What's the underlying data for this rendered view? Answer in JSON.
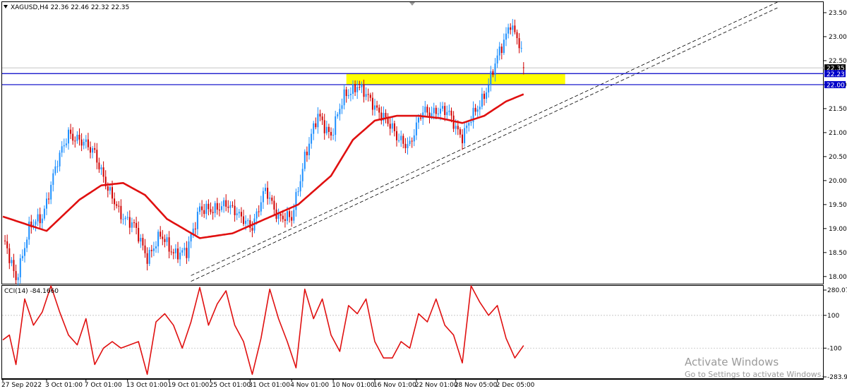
{
  "header": {
    "symbol_info": "XAGUSD,H4  22.36 22.46 22.32 22.35"
  },
  "indicator": {
    "label": "CCI(14) -84.1660",
    "levels": [
      "280.072",
      "100",
      "-100",
      "-283.925"
    ]
  },
  "price_axis": {
    "ticks": [
      "23.50",
      "23.00",
      "22.50",
      "22.00",
      "21.50",
      "21.00",
      "20.50",
      "20.00",
      "19.50",
      "19.00",
      "18.50",
      "18.00"
    ]
  },
  "time_axis": {
    "ticks": [
      "27 Sep 2022",
      "3 Oct 01:00",
      "7 Oct 01:00",
      "13 Oct 01:00",
      "19 Oct 01:00",
      "25 Oct 01:00",
      "31 Oct 01:00",
      "4 Nov 01:00",
      "10 Nov 01:00",
      "16 Nov 01:00",
      "22 Nov 01:00",
      "28 Nov 05:00",
      "2 Dec 05:00"
    ]
  },
  "markers": {
    "current_price": "22.35",
    "level_upper": "22.23",
    "level_lower": "22.00"
  },
  "watermark": {
    "title": "Activate Windows",
    "subtitle": "Go to Settings to activate Windows."
  },
  "colors": {
    "bull_candle": "#1e90ff",
    "bear_candle": "#d00000",
    "moving_average": "#e01010",
    "cci_line": "#e01010",
    "level_line": "#0000c8",
    "zone_fill": "#ffff00",
    "trend_line": "#000000"
  },
  "chart_data": {
    "type": "candlestick",
    "symbol": "XAGUSD",
    "timeframe": "H4",
    "ohlc_last": {
      "open": 22.36,
      "high": 22.46,
      "low": 22.32,
      "close": 22.35
    },
    "ylim": [
      17.85,
      23.72
    ],
    "close_path": [
      {
        "bar": 0,
        "close": 18.75
      },
      {
        "bar": 6,
        "close": 18.0
      },
      {
        "bar": 12,
        "close": 18.95
      },
      {
        "bar": 18,
        "close": 19.3
      },
      {
        "bar": 24,
        "close": 20.2
      },
      {
        "bar": 30,
        "close": 21.05
      },
      {
        "bar": 36,
        "close": 20.75
      },
      {
        "bar": 42,
        "close": 20.65
      },
      {
        "bar": 48,
        "close": 19.75
      },
      {
        "bar": 54,
        "close": 19.35
      },
      {
        "bar": 60,
        "close": 19.0
      },
      {
        "bar": 66,
        "close": 18.45
      },
      {
        "bar": 72,
        "close": 18.8
      },
      {
        "bar": 78,
        "close": 18.55
      },
      {
        "bar": 84,
        "close": 18.45
      },
      {
        "bar": 90,
        "close": 19.5
      },
      {
        "bar": 96,
        "close": 19.3
      },
      {
        "bar": 102,
        "close": 19.6
      },
      {
        "bar": 108,
        "close": 19.2
      },
      {
        "bar": 114,
        "close": 19.1
      },
      {
        "bar": 120,
        "close": 19.75
      },
      {
        "bar": 126,
        "close": 19.3
      },
      {
        "bar": 132,
        "close": 19.15
      },
      {
        "bar": 138,
        "close": 20.55
      },
      {
        "bar": 144,
        "close": 21.3
      },
      {
        "bar": 150,
        "close": 21.0
      },
      {
        "bar": 156,
        "close": 21.7
      },
      {
        "bar": 162,
        "close": 22.05
      },
      {
        "bar": 168,
        "close": 21.6
      },
      {
        "bar": 174,
        "close": 21.4
      },
      {
        "bar": 180,
        "close": 20.85
      },
      {
        "bar": 186,
        "close": 20.8
      },
      {
        "bar": 192,
        "close": 21.4
      },
      {
        "bar": 198,
        "close": 21.5
      },
      {
        "bar": 204,
        "close": 21.35
      },
      {
        "bar": 210,
        "close": 20.95
      },
      {
        "bar": 216,
        "close": 21.4
      },
      {
        "bar": 222,
        "close": 22.05
      },
      {
        "bar": 228,
        "close": 22.75
      },
      {
        "bar": 232,
        "close": 23.35
      },
      {
        "bar": 236,
        "close": 22.85
      },
      {
        "bar": 238,
        "close": 22.35
      }
    ],
    "moving_average": [
      {
        "bar": 0,
        "value": 19.25
      },
      {
        "bar": 20,
        "value": 18.95
      },
      {
        "bar": 35,
        "value": 19.6
      },
      {
        "bar": 45,
        "value": 19.9
      },
      {
        "bar": 55,
        "value": 19.95
      },
      {
        "bar": 65,
        "value": 19.7
      },
      {
        "bar": 75,
        "value": 19.2
      },
      {
        "bar": 90,
        "value": 18.8
      },
      {
        "bar": 105,
        "value": 18.9
      },
      {
        "bar": 120,
        "value": 19.2
      },
      {
        "bar": 135,
        "value": 19.5
      },
      {
        "bar": 150,
        "value": 20.1
      },
      {
        "bar": 160,
        "value": 20.85
      },
      {
        "bar": 170,
        "value": 21.25
      },
      {
        "bar": 180,
        "value": 21.35
      },
      {
        "bar": 190,
        "value": 21.35
      },
      {
        "bar": 200,
        "value": 21.3
      },
      {
        "bar": 210,
        "value": 21.2
      },
      {
        "bar": 220,
        "value": 21.35
      },
      {
        "bar": 230,
        "value": 21.65
      },
      {
        "bar": 238,
        "value": 21.8
      }
    ],
    "horizontal_levels": [
      22.23,
      22.0
    ],
    "current_price_line": 22.35,
    "zone": {
      "from_bar": 157,
      "to_bar": 257,
      "low": 22.0,
      "high": 22.23
    },
    "trendlines": [
      {
        "from": {
          "bar": 86,
          "price": 18.02
        },
        "to": {
          "bar": 354,
          "price": 23.72
        }
      },
      {
        "from": {
          "bar": 86,
          "price": 17.9
        },
        "to": {
          "bar": 354,
          "price": 23.6
        }
      }
    ],
    "cci": {
      "ylim": [
        -283.925,
        280.072
      ],
      "levels": [
        100,
        -100
      ],
      "points": [
        {
          "bar": 0,
          "value": -50
        },
        {
          "bar": 3,
          "value": -20
        },
        {
          "bar": 6,
          "value": -200
        },
        {
          "bar": 10,
          "value": 200
        },
        {
          "bar": 14,
          "value": 40
        },
        {
          "bar": 18,
          "value": 120
        },
        {
          "bar": 22,
          "value": 280
        },
        {
          "bar": 26,
          "value": 120
        },
        {
          "bar": 30,
          "value": -20
        },
        {
          "bar": 34,
          "value": -80
        },
        {
          "bar": 38,
          "value": 80
        },
        {
          "bar": 42,
          "value": -200
        },
        {
          "bar": 46,
          "value": -100
        },
        {
          "bar": 50,
          "value": -60
        },
        {
          "bar": 54,
          "value": -100
        },
        {
          "bar": 58,
          "value": -80
        },
        {
          "bar": 62,
          "value": -60
        },
        {
          "bar": 66,
          "value": -260
        },
        {
          "bar": 70,
          "value": 60
        },
        {
          "bar": 74,
          "value": 110
        },
        {
          "bar": 78,
          "value": 40
        },
        {
          "bar": 82,
          "value": -100
        },
        {
          "bar": 86,
          "value": 60
        },
        {
          "bar": 90,
          "value": 270
        },
        {
          "bar": 94,
          "value": 40
        },
        {
          "bar": 98,
          "value": 170
        },
        {
          "bar": 102,
          "value": 250
        },
        {
          "bar": 106,
          "value": 40
        },
        {
          "bar": 110,
          "value": -60
        },
        {
          "bar": 114,
          "value": -260
        },
        {
          "bar": 118,
          "value": -40
        },
        {
          "bar": 122,
          "value": 260
        },
        {
          "bar": 126,
          "value": 80
        },
        {
          "bar": 130,
          "value": -60
        },
        {
          "bar": 134,
          "value": -220
        },
        {
          "bar": 138,
          "value": 260
        },
        {
          "bar": 142,
          "value": 80
        },
        {
          "bar": 146,
          "value": 200
        },
        {
          "bar": 150,
          "value": -20
        },
        {
          "bar": 154,
          "value": -120
        },
        {
          "bar": 158,
          "value": 160
        },
        {
          "bar": 162,
          "value": 110
        },
        {
          "bar": 166,
          "value": 200
        },
        {
          "bar": 170,
          "value": -60
        },
        {
          "bar": 174,
          "value": -160
        },
        {
          "bar": 178,
          "value": -160
        },
        {
          "bar": 182,
          "value": -60
        },
        {
          "bar": 186,
          "value": -100
        },
        {
          "bar": 190,
          "value": 110
        },
        {
          "bar": 194,
          "value": 60
        },
        {
          "bar": 198,
          "value": 200
        },
        {
          "bar": 202,
          "value": 40
        },
        {
          "bar": 206,
          "value": -20
        },
        {
          "bar": 210,
          "value": -190
        },
        {
          "bar": 214,
          "value": 280
        },
        {
          "bar": 218,
          "value": 180
        },
        {
          "bar": 222,
          "value": 100
        },
        {
          "bar": 226,
          "value": 160
        },
        {
          "bar": 230,
          "value": -40
        },
        {
          "bar": 234,
          "value": -160
        },
        {
          "bar": 238,
          "value": -84
        }
      ]
    }
  }
}
